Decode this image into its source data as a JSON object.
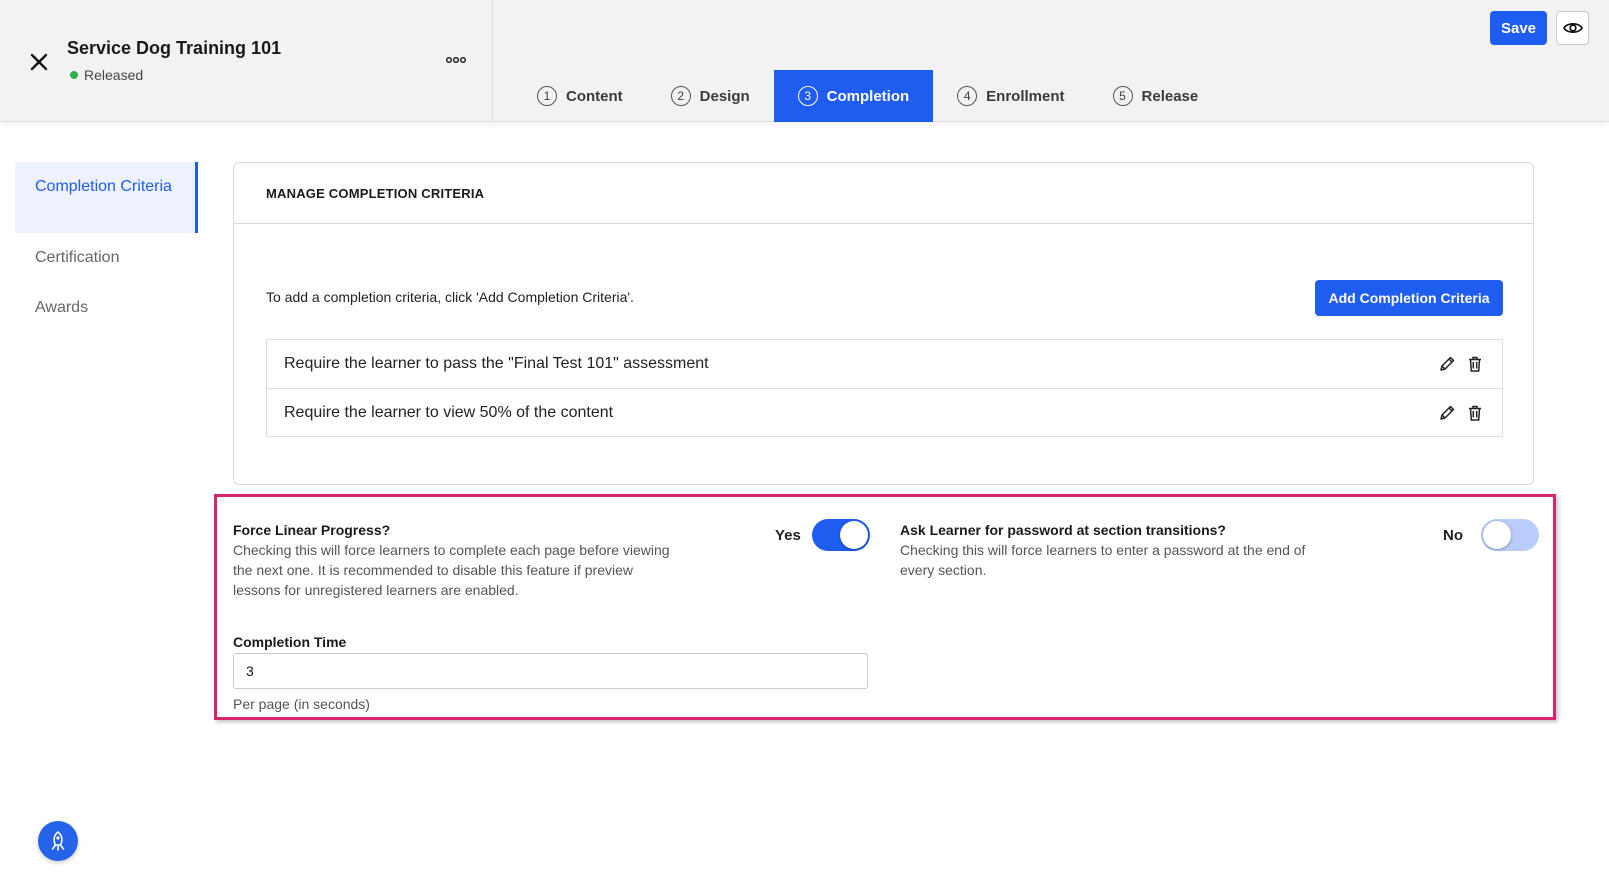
{
  "header": {
    "title": "Service Dog Training 101",
    "status": "Released",
    "save_label": "Save",
    "tabs": [
      {
        "num": "1",
        "label": "Content"
      },
      {
        "num": "2",
        "label": "Design"
      },
      {
        "num": "3",
        "label": "Completion"
      },
      {
        "num": "4",
        "label": "Enrollment"
      },
      {
        "num": "5",
        "label": "Release"
      }
    ],
    "active_tab": "Completion"
  },
  "sidebar": {
    "items": [
      {
        "label": "Completion Criteria"
      },
      {
        "label": "Certification"
      },
      {
        "label": "Awards"
      }
    ]
  },
  "criteria": {
    "heading": "MANAGE COMPLETION CRITERIA",
    "hint": "To add a completion criteria, click 'Add Completion Criteria'.",
    "add_label": "Add Completion Criteria",
    "rows": [
      {
        "text": "Require the learner to pass the \"Final Test 101\" assessment"
      },
      {
        "text": "Require the learner to view 50% of the content"
      }
    ]
  },
  "settings": {
    "linear": {
      "title": "Force Linear Progress?",
      "desc": "Checking this will force learners to complete each page before viewing the next one. It is recommended to disable this feature if preview lessons for unregistered learners are enabled.",
      "toggle_label": "Yes",
      "enabled": true
    },
    "password": {
      "title": "Ask Learner for password at section transitions?",
      "desc": "Checking this will force learners to enter a password at the end of every section.",
      "toggle_label": "No",
      "enabled": false
    },
    "completion_time": {
      "label": "Completion Time",
      "value": "3",
      "help": "Per page (in seconds)"
    }
  },
  "colors": {
    "accent": "#1f5cf0",
    "highlight_border": "#d6246e",
    "status_green": "#2fb34a"
  }
}
